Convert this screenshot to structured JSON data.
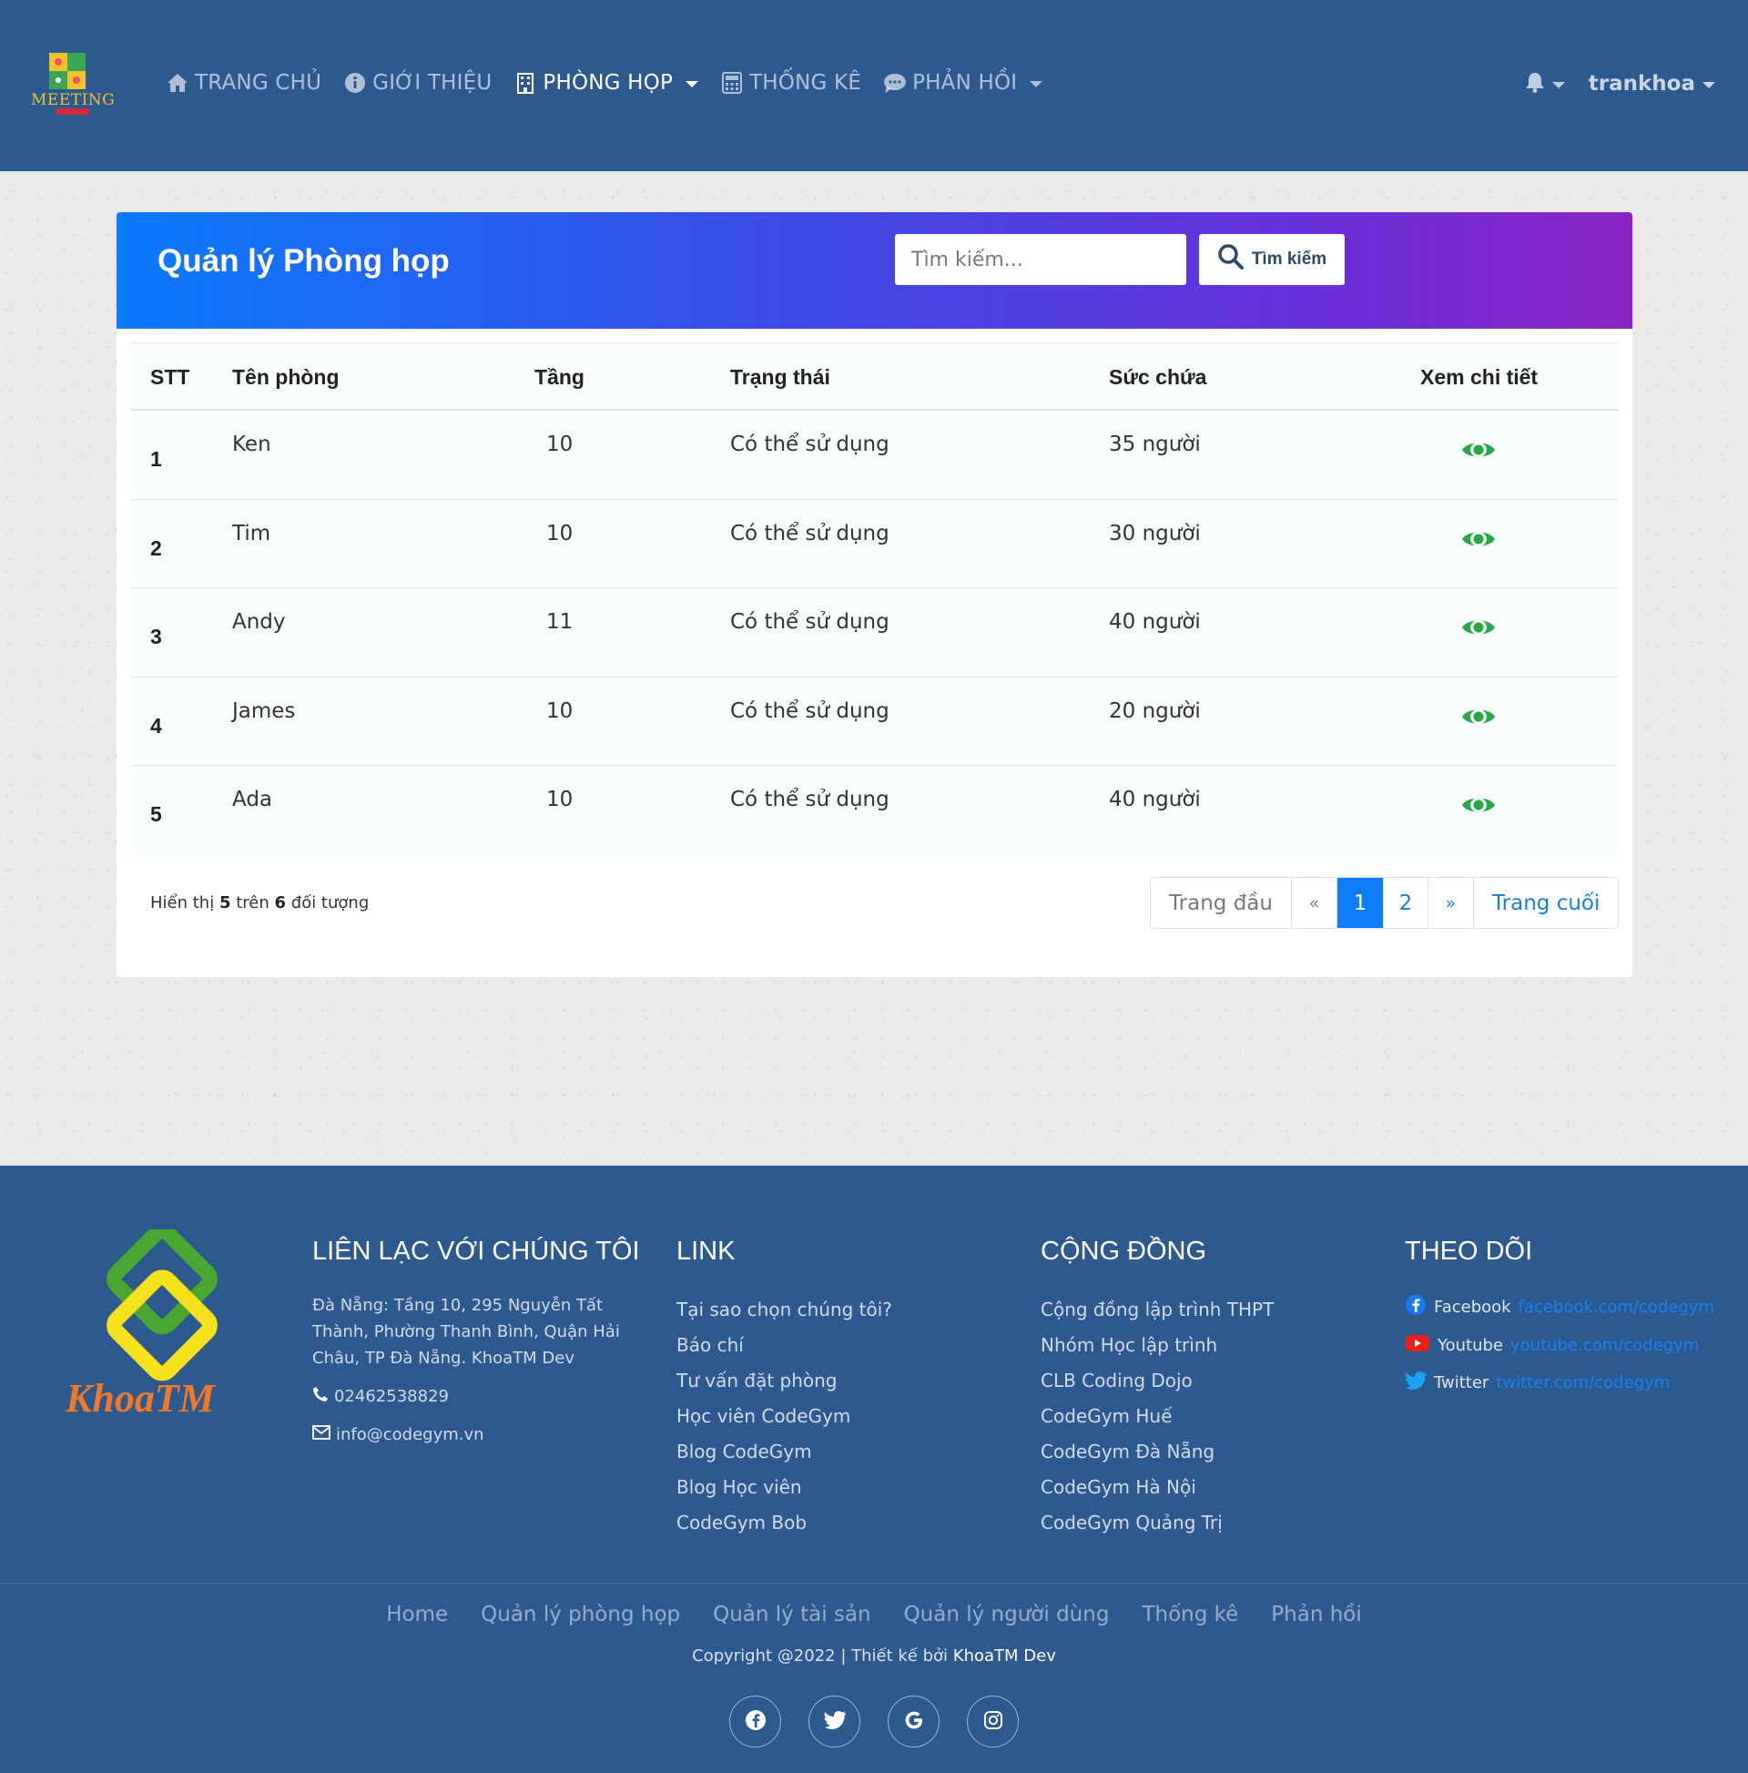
{
  "nav": {
    "brand_text": "MEETING",
    "items": [
      {
        "label": "TRANG CHỦ",
        "icon": "home-icon"
      },
      {
        "label": "GIỚI THIỆU",
        "icon": "info-icon"
      },
      {
        "label": "PHÒNG HỌP",
        "icon": "building-icon",
        "active": true,
        "dropdown": true
      },
      {
        "label": "THỐNG KÊ",
        "icon": "calculator-icon"
      },
      {
        "label": "PHẢN HỒI",
        "icon": "comments-icon",
        "dropdown": true
      }
    ],
    "user": "trankhoa"
  },
  "card": {
    "title": "Quản lý Phòng họp",
    "search_placeholder": "Tìm kiếm...",
    "search_button": "Tìm kiếm"
  },
  "table": {
    "headers": [
      "STT",
      "Tên phòng",
      "Tầng",
      "Trạng thái",
      "Sức chứa",
      "Xem chi tiết"
    ],
    "rows": [
      {
        "stt": "1",
        "name": "Ken",
        "floor": "10",
        "status": "Có thể sử dụng",
        "capacity": "35 người"
      },
      {
        "stt": "2",
        "name": "Tim",
        "floor": "10",
        "status": "Có thể sử dụng",
        "capacity": "30 người"
      },
      {
        "stt": "3",
        "name": "Andy",
        "floor": "11",
        "status": "Có thể sử dụng",
        "capacity": "40 người"
      },
      {
        "stt": "4",
        "name": "James",
        "floor": "10",
        "status": "Có thể sử dụng",
        "capacity": "20 người"
      },
      {
        "stt": "5",
        "name": "Ada",
        "floor": "10",
        "status": "Có thể sử dụng",
        "capacity": "40 người"
      }
    ]
  },
  "summary": {
    "prefix": "Hiển thị",
    "shown": "5",
    "middle": "trên",
    "total": "6",
    "suffix": "đối tượng"
  },
  "pagination": {
    "first": "Trang đầu",
    "prev": "«",
    "pages": [
      "1",
      "2"
    ],
    "current": "1",
    "next": "»",
    "last": "Trang cuối"
  },
  "footer": {
    "logo_text": "KhoaTM",
    "contact": {
      "heading": "LIÊN LẠC VỚI CHÚNG TÔI",
      "address": "Đà Nẵng: Tầng 10, 295 Nguyễn Tất Thành, Phường Thanh Bình, Quận Hải Châu, TP Đà Nẵng. KhoaTM Dev",
      "phone": "02462538829",
      "email": "info@codegym.vn"
    },
    "links": {
      "heading": "LINK",
      "items": [
        "Tại sao chọn chúng tôi?",
        "Báo chí",
        "Tư vấn đặt phòng",
        "Học viên CodeGym",
        "Blog CodeGym",
        "Blog Học viên",
        "CodeGym Bob"
      ]
    },
    "community": {
      "heading": "CỘNG ĐỒNG",
      "items": [
        "Cộng đồng lập trình THPT",
        "Nhóm Học lập trình",
        "CLB Coding Dojo",
        "CodeGym Huế",
        "CodeGym Đà Nẵng",
        "CodeGym Hà Nội",
        "CodeGym Quảng Trị"
      ]
    },
    "follow": {
      "heading": "THEO DÕI",
      "items": [
        {
          "label": "Facebook",
          "link": "facebook.com/codegym",
          "icon": "facebook-icon"
        },
        {
          "label": "Youtube",
          "link": "youtube.com/codegym",
          "icon": "youtube-icon"
        },
        {
          "label": "Twitter",
          "link": "twitter.com/codegym",
          "icon": "twitter-icon"
        }
      ]
    },
    "bottom_nav": [
      "Home",
      "Quản lý phòng họp",
      "Quản lý tài sản",
      "Quản lý người dùng",
      "Thống kê",
      "Phản hồi"
    ],
    "copyright_prefix": "Copyright @2022 | Thiết kế bởi",
    "copyright_author": "KhoaTM Dev",
    "socials": [
      "facebook-icon",
      "twitter-icon",
      "google-icon",
      "instagram-icon"
    ]
  },
  "colors": {
    "navbar": "#2d5a8e",
    "accent": "#0d7cf6",
    "eye": "#28a745"
  }
}
